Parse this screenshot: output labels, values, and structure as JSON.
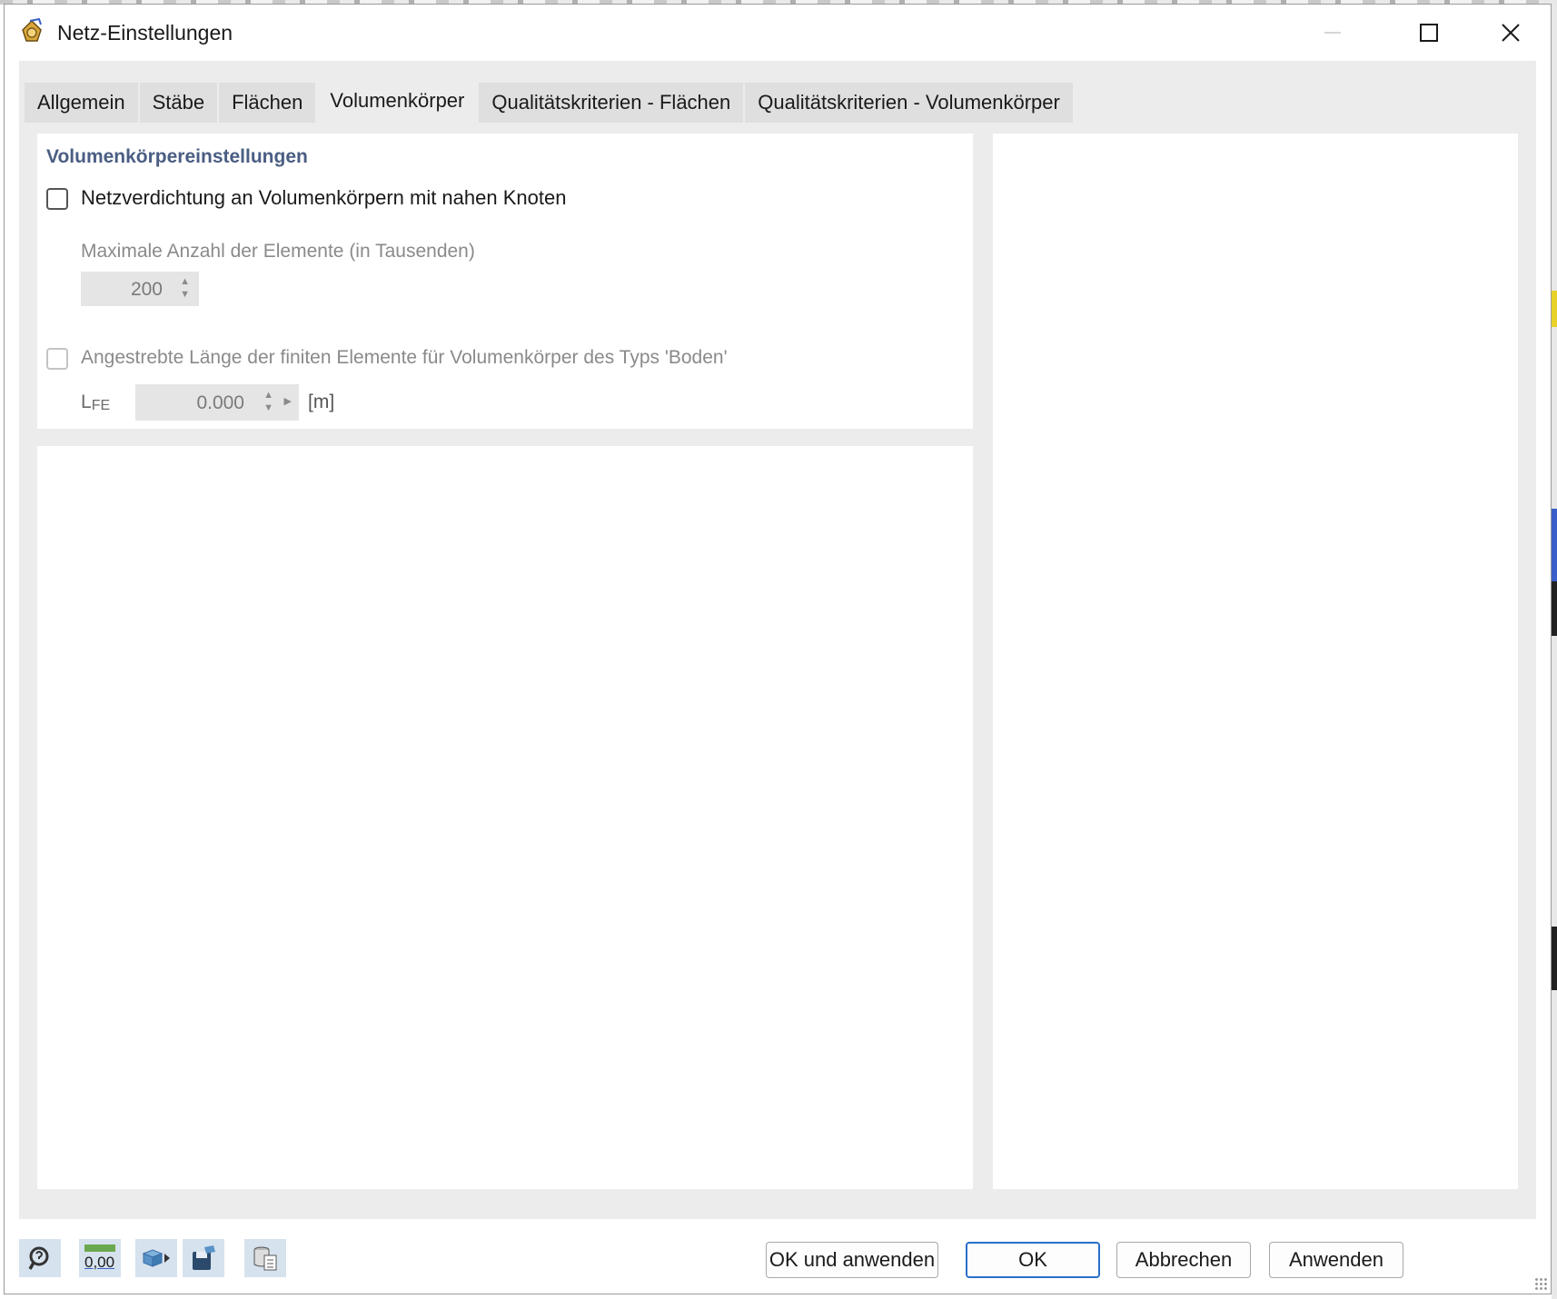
{
  "window": {
    "title": "Netz-Einstellungen",
    "icon": "mesh-settings-app-icon"
  },
  "tabs": [
    {
      "label": "Allgemein",
      "active": false
    },
    {
      "label": "Stäbe",
      "active": false
    },
    {
      "label": "Flächen",
      "active": false
    },
    {
      "label": "Volumenkörper",
      "active": true
    },
    {
      "label": "Qualitätskriterien - Flächen",
      "active": false
    },
    {
      "label": "Qualitätskriterien - Volumenkörper",
      "active": false
    }
  ],
  "settings": {
    "section_title": "Volumenkörpereinstellungen",
    "refinement": {
      "label": "Netzverdichtung an Volumenkörpern mit nahen Knoten",
      "checked": false,
      "max_elements_label": "Maximale Anzahl der Elemente (in Tausenden)",
      "max_elements_value": "200"
    },
    "soil_length": {
      "label": "Angestrebte Länge der finiten Elemente für Volumenkörper des Typs 'Boden'",
      "checked": false,
      "lfe_label": "L",
      "lfe_sub": "FE",
      "lfe_value": "0.000",
      "unit": "[m]"
    }
  },
  "footer": {
    "icon_buttons": [
      "help-icon",
      "units-icon",
      "view-icon",
      "save-icon",
      "library-icon"
    ],
    "units_icon_text": "0,00",
    "ok_apply_label": "OK und anwenden",
    "ok_label": "OK",
    "cancel_label": "Abbrechen",
    "apply_label": "Anwenden"
  },
  "colors": {
    "section_title": "#4a5d83",
    "primary_border": "#2a6fc9",
    "icon_button_bg": "#d6e2ee"
  }
}
